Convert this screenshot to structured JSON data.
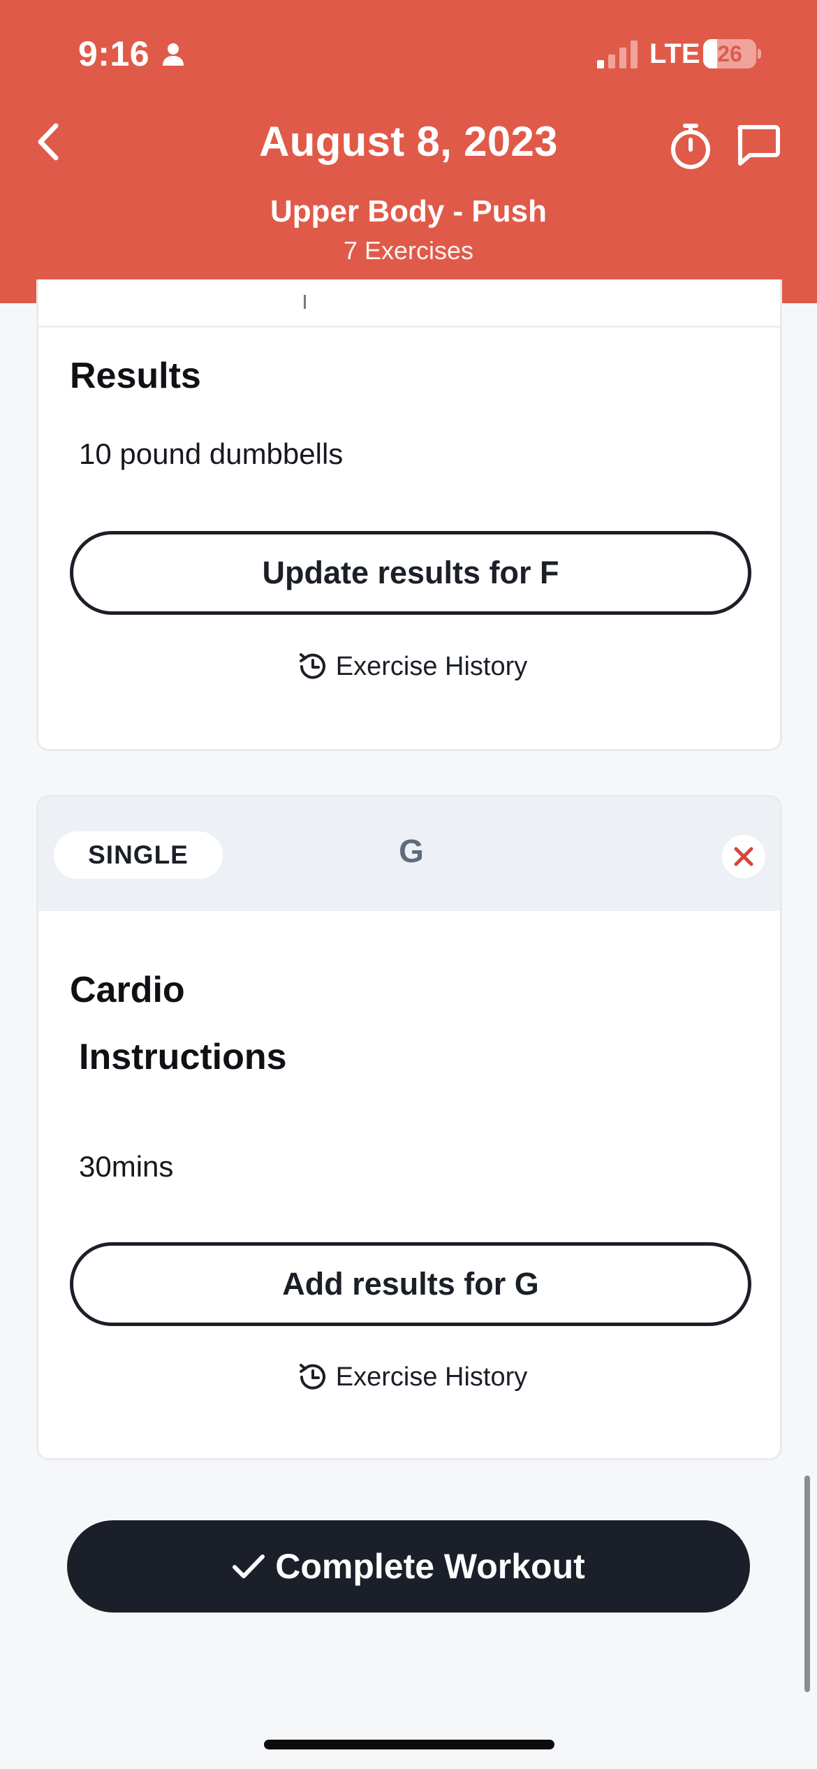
{
  "status_bar": {
    "time": "9:16",
    "network": "LTE",
    "battery": "26",
    "battery_level": 0.26
  },
  "header": {
    "title": "August 8, 2023",
    "subtitle": "Upper Body - Push",
    "exercise_count": "7 Exercises",
    "background_color": "#e05a49"
  },
  "card_f": {
    "results_heading": "Results",
    "results_text": "10 pound dumbbells",
    "update_button_label": "Update results for F",
    "history_label": "Exercise History"
  },
  "card_g": {
    "type_badge": "SINGLE",
    "letter": "G",
    "exercise_name": "Cardio",
    "instructions_heading": "Instructions",
    "instructions_text": "30mins",
    "add_button_label": "Add results for G",
    "history_label": "Exercise History"
  },
  "footer": {
    "complete_button_label": "Complete Workout"
  },
  "icons": {
    "back": "chevron-left-icon",
    "timer": "stopwatch-icon",
    "chat": "chat-bubble-icon",
    "history": "history-clock-icon",
    "remove": "close-x-icon",
    "complete": "checkmark-icon"
  },
  "colors": {
    "accent": "#e05a49",
    "dark_button": "#1b1f2a",
    "remove_red": "#d9443a"
  }
}
